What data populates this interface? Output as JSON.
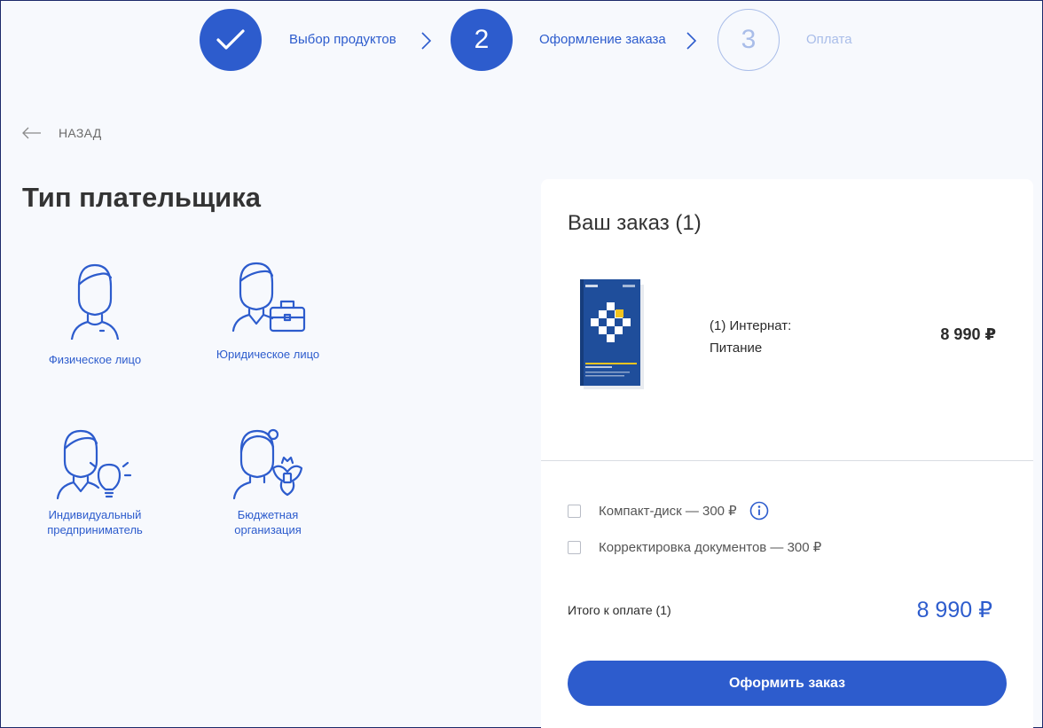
{
  "stepper": {
    "steps": [
      {
        "number": "",
        "label": "Выбор продуктов",
        "state": "done"
      },
      {
        "number": "2",
        "label": "Оформление заказа",
        "state": "current"
      },
      {
        "number": "3",
        "label": "Оплата",
        "state": "upcoming"
      }
    ]
  },
  "back": {
    "label": "НАЗАД",
    "icon": "arrow-left-icon"
  },
  "payer_section": {
    "title": "Тип плательщика",
    "options": [
      {
        "label": "Физическое лицо",
        "icon": "person-icon"
      },
      {
        "label": "Юридическое лицо",
        "icon": "person-briefcase-icon"
      },
      {
        "label_line1": "Индивидуальный",
        "label_line2": "предприниматель",
        "icon": "person-lightbulb-icon"
      },
      {
        "label_line1": "Бюджетная",
        "label_line2": "организация",
        "icon": "person-emblem-icon"
      }
    ]
  },
  "order": {
    "title": "Ваш заказ (1)",
    "item": {
      "name_line1": "(1) Интернат:",
      "name_line2": "Питание",
      "price": "8 990 ₽"
    },
    "options": [
      {
        "label": "Компакт-диск — 300 ₽",
        "checked": false,
        "has_info": true
      },
      {
        "label": "Корректировка документов — 300 ₽",
        "checked": false,
        "has_info": false
      }
    ],
    "total_label": "Итого к оплате (1)",
    "total_value": "8 990 ₽",
    "submit_label": "Оформить заказ"
  },
  "colors": {
    "accent": "#2d5ccd",
    "muted": "#a9bde9",
    "background": "#f7f9fd",
    "card": "#ffffff"
  }
}
